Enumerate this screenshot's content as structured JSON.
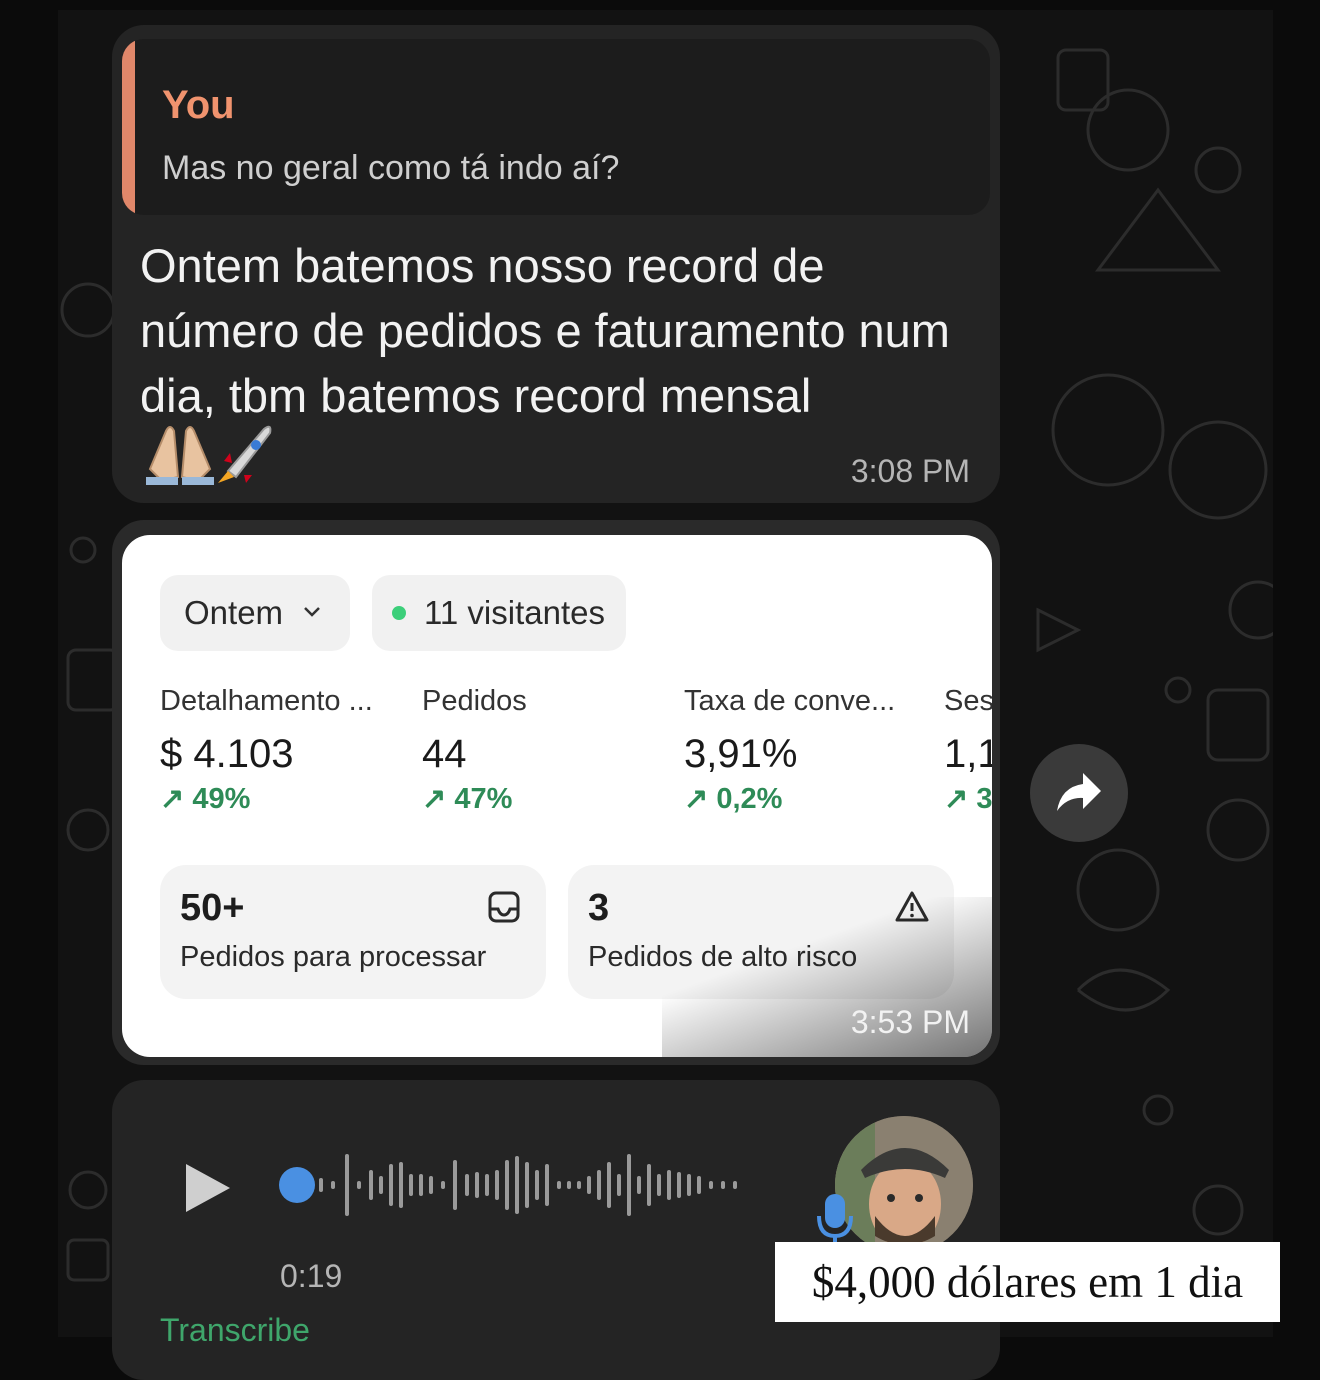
{
  "chat": {
    "reply_message": {
      "quote_author": "You",
      "quote_text": "Mas no geral como tá indo aí?",
      "text": "Ontem batemos nosso record de número de pedidos e faturamento num dia, tbm batemos record mensal",
      "emojis": "🙏🏼🚀",
      "time": "3:08 PM"
    },
    "image_message": {
      "time": "3:53 PM",
      "dashboard": {
        "period_dropdown": "Ontem",
        "visitors_label": "11 visitantes",
        "metrics": [
          {
            "label": "Detalhamento ...",
            "value": "$ 4.103",
            "change": "↗ 49%"
          },
          {
            "label": "Pedidos",
            "value": "44",
            "change": "↗ 47%"
          },
          {
            "label": "Taxa de conve...",
            "value": "3,91%",
            "change": "↗ 0,2%"
          },
          {
            "label": "Ses",
            "value": "1,1",
            "change": "↗ 3"
          }
        ],
        "cards": [
          {
            "count": "50+",
            "label": "Pedidos para processar",
            "icon": "inbox-icon"
          },
          {
            "count": "3",
            "label": "Pedidos de alto risco",
            "icon": "warning-icon"
          }
        ],
        "accent_green": "#2e8b57"
      }
    },
    "voice_message": {
      "duration": "0:19",
      "transcribe_label": "Transcribe"
    },
    "forward_icon": "forward-icon"
  },
  "caption": {
    "text": "$4,000 dólares em 1 dia"
  },
  "colors": {
    "quote_author": "#f0936e",
    "bubble": "#242424",
    "background": "#121212"
  }
}
